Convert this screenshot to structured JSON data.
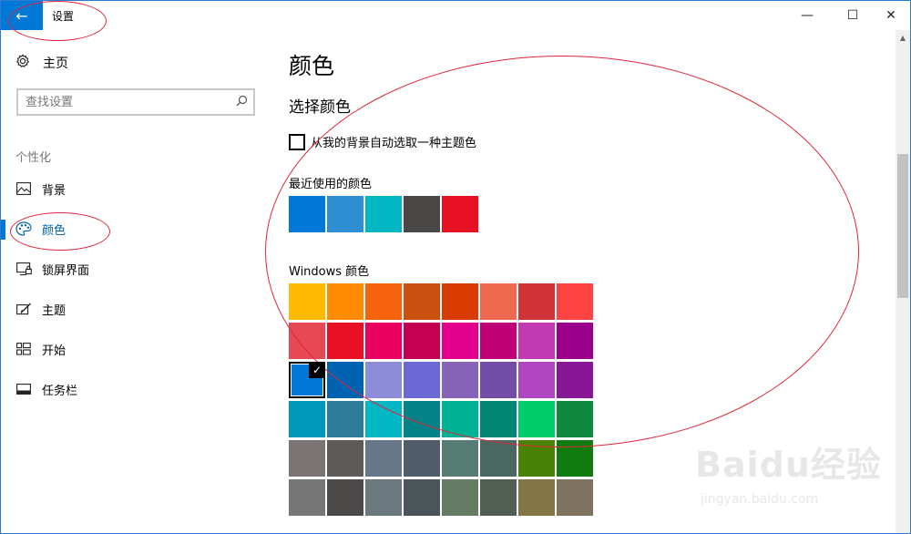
{
  "titlebar": {
    "app_title": "设置",
    "back_glyph": "←",
    "minimize_glyph": "—",
    "maximize_glyph": "☐",
    "close_glyph": "✕"
  },
  "sidebar": {
    "home_label": "主页",
    "home_icon": "gear-icon",
    "search_placeholder": "查找设置",
    "section_label": "个性化",
    "items": [
      {
        "label": "背景",
        "icon": "picture-icon"
      },
      {
        "label": "颜色",
        "icon": "palette-icon",
        "active": true
      },
      {
        "label": "锁屏界面",
        "icon": "lock-screen-icon"
      },
      {
        "label": "主题",
        "icon": "theme-brush-icon"
      },
      {
        "label": "开始",
        "icon": "start-tiles-icon"
      },
      {
        "label": "任务栏",
        "icon": "taskbar-icon"
      }
    ]
  },
  "main": {
    "page_title": "颜色",
    "section_title": "选择颜色",
    "auto_pick_label": "从我的背景自动选取一种主题色",
    "auto_pick_checked": false,
    "recent_label": "最近使用的颜色",
    "recent_colors": [
      "#0078d7",
      "#2d8fd2",
      "#00b7c3",
      "#4a4846",
      "#e81123"
    ],
    "windows_label": "Windows 颜色",
    "windows_colors": [
      [
        "#ffb900",
        "#ff8c00",
        "#f7630c",
        "#ca5010",
        "#da3b01",
        "#ef6950",
        "#d13438",
        "#ff4343"
      ],
      [
        "#e74856",
        "#e81123",
        "#ea005e",
        "#c30052",
        "#e3008c",
        "#bf0077",
        "#c239b3",
        "#9a0089"
      ],
      [
        "#0078d7",
        "#0063b1",
        "#8e8cd8",
        "#6b69d6",
        "#8764b8",
        "#744da9",
        "#b146c2",
        "#881798"
      ],
      [
        "#0099bc",
        "#2d7d9a",
        "#00b7c3",
        "#038387",
        "#00b294",
        "#018574",
        "#00cc6a",
        "#10893e"
      ],
      [
        "#7a7574",
        "#5d5a58",
        "#68768a",
        "#515c6b",
        "#567c73",
        "#486860",
        "#498205",
        "#107c10"
      ],
      [
        "#767676",
        "#4c4a48",
        "#69797e",
        "#4a5459",
        "#647c64",
        "#525e54",
        "#847545",
        "#7e735f"
      ]
    ],
    "selected_color": "#0078d7",
    "check_glyph": "✓"
  },
  "watermark": {
    "logo": "Baidu经验",
    "url": "jingyan.baidu.com"
  },
  "colors": {
    "accent": "#0078d7",
    "annotation": "#e0263b"
  }
}
